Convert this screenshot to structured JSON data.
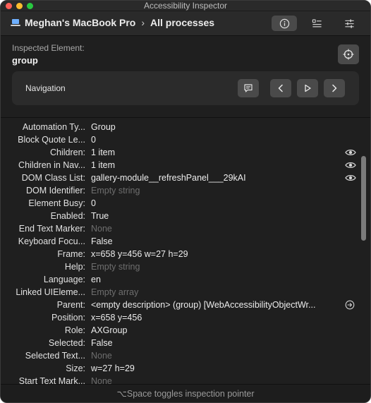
{
  "window": {
    "title": "Accessibility Inspector"
  },
  "toolbar": {
    "device": "Meghan's MacBook Pro",
    "separator": "›",
    "target": "All processes",
    "buttons": [
      {
        "icon": "info-icon",
        "active": true
      },
      {
        "icon": "inspector-list-icon",
        "active": false
      },
      {
        "icon": "settings-sliders-icon",
        "active": false
      }
    ]
  },
  "inspected": {
    "label": "Inspected Element:",
    "value": "group"
  },
  "navigation": {
    "label": "Navigation",
    "buttons": [
      "speech-bubble-icon",
      "previous-icon",
      "play-icon",
      "next-icon"
    ]
  },
  "properties": [
    {
      "key": "Automation Ty...",
      "value": "Group",
      "muted": false
    },
    {
      "key": "Block Quote Le...",
      "value": "0",
      "muted": false
    },
    {
      "key": "Children:",
      "value": "1 item",
      "muted": false,
      "icon": "eye-icon"
    },
    {
      "key": "Children in Nav...",
      "value": "1 item",
      "muted": false,
      "icon": "eye-icon"
    },
    {
      "key": "DOM Class List:",
      "value": "gallery-module__refreshPanel___29kAI",
      "muted": false,
      "icon": "eye-icon"
    },
    {
      "key": "DOM Identifier:",
      "value": "Empty string",
      "muted": true
    },
    {
      "key": "Element Busy:",
      "value": "0",
      "muted": false
    },
    {
      "key": "Enabled:",
      "value": "True",
      "muted": false
    },
    {
      "key": "End Text Marker:",
      "value": "None",
      "muted": true
    },
    {
      "key": "Keyboard Focu...",
      "value": "False",
      "muted": false
    },
    {
      "key": "Frame:",
      "value": "x=658 y=456 w=27 h=29",
      "muted": false
    },
    {
      "key": "Help:",
      "value": "Empty string",
      "muted": true
    },
    {
      "key": "Language:",
      "value": "en",
      "muted": false
    },
    {
      "key": "Linked UIEleme...",
      "value": "Empty array",
      "muted": true
    },
    {
      "key": "Parent:",
      "value": "<empty description> (group) [WebAccessibilityObjectWr...",
      "muted": false,
      "icon": "arrow-circle-icon"
    },
    {
      "key": "Position:",
      "value": "x=658 y=456",
      "muted": false
    },
    {
      "key": "Role:",
      "value": "AXGroup",
      "muted": false
    },
    {
      "key": "Selected:",
      "value": "False",
      "muted": false
    },
    {
      "key": "Selected Text...",
      "value": "None",
      "muted": true
    },
    {
      "key": "Size:",
      "value": "w=27 h=29",
      "muted": false
    },
    {
      "key": "Start Text Mark...",
      "value": "None",
      "muted": true
    }
  ],
  "status": {
    "text": "⌥Space toggles inspection pointer"
  }
}
